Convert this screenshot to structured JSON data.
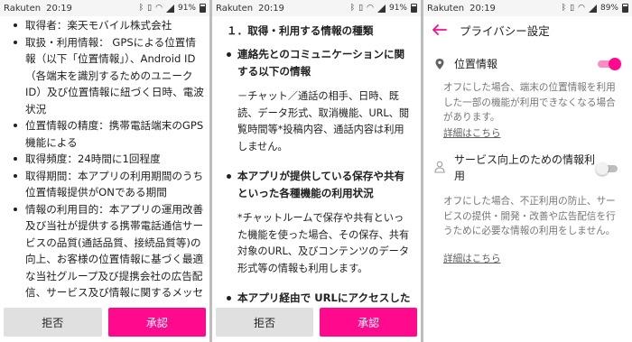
{
  "colors": {
    "accent": "#ff0a8c",
    "reject_bg": "#e0e0e0",
    "page_gap": "#bdbdbd"
  },
  "screen1": {
    "status": {
      "carrier": "Rakuten",
      "time": "20:19",
      "battery": "91%"
    },
    "items": [
      "取得者：楽天モバイル株式会社",
      "取扱・利用情報： GPSによる位置情報（以下「位置情報」）、Android ID（各端末を識別するためのユニークID）及び位置情報に紐づく日時、電波状況",
      "位置情報の精度：携帯電話端末のGPS機能による",
      "取得頻度：24時間に1回程度",
      "取得期間：本アプリの利用期間のうち位置情報提供がONである期間",
      "情報の利用目的：本アプリの運用改善及び当社が提供する携帯電話通信サービスの品質(通話品質、接続品質等)の向上、お客様の位置情報に基づく最適な当社グループ及び提携会社の広告配信、サービス及び情報に関するメッセージ等の送付等"
    ],
    "buttons": {
      "reject": "拒否",
      "accept": "承認"
    }
  },
  "screen2": {
    "status": {
      "carrier": "Rakuten",
      "time": "20:19",
      "battery": "91%"
    },
    "heading": "１．取得・利用する情報の種類",
    "sections": [
      {
        "title": "連絡先とのコミュニケーションに関する以下の情報",
        "body": "－チャット／通話の相手、日時、既読、データ形式、取消機能、URL、閲覧時間等*投稿内容、通話内容は利用しません。"
      },
      {
        "title": "本アプリが提供している保存や共有といった各種機能の利用状況",
        "body": "*チャットルームで保存や共有といった機能を使った場合、その保存、共有対象のURL、及びコンテンツのデータ形式等の情報も利用します。"
      },
      {
        "title": "本アプリ経由で URLにアクセスした",
        "body": ""
      }
    ],
    "buttons": {
      "reject": "拒否",
      "accept": "承認"
    }
  },
  "screen3": {
    "status": {
      "carrier": "Rakuten",
      "time": "20:19",
      "battery": "89%"
    },
    "title": "プライバシー設定",
    "settings": [
      {
        "title": "位置情報",
        "enabled": true,
        "description": "オフにした場合、端末の位置情報を利用した一部の機能が利用できなくなる場合があります。",
        "link": "詳細はこちら"
      },
      {
        "title": "サービス向上のための情報利用",
        "enabled": false,
        "description": "オフにした場合、不正利用の防止、サービスの提供・開発・改善や広告配信を行うために必要な情報の利用をしません。",
        "link": "詳細はこちら"
      }
    ]
  }
}
